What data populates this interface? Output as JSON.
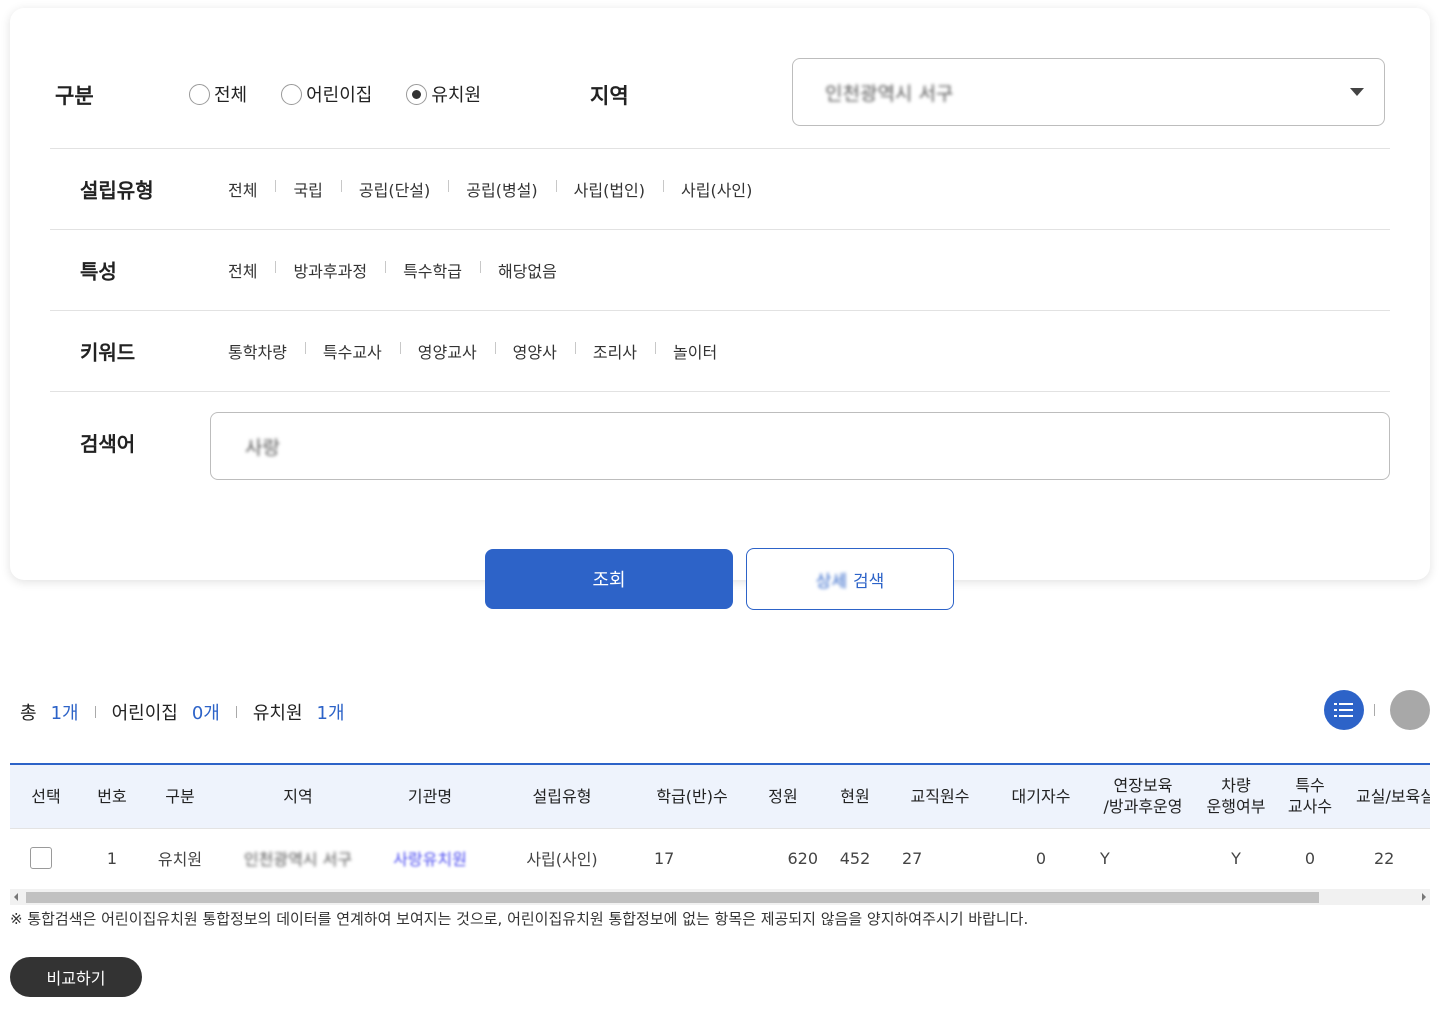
{
  "filters": {
    "type_label": "구분",
    "type_options": [
      "전체",
      "어린이집",
      "유치원"
    ],
    "type_selected": "유치원",
    "region_label": "지역",
    "region_value": "인천광역시 서구",
    "establish_label": "설립유형",
    "establish_options": [
      "전체",
      "국립",
      "공립(단설)",
      "공립(병설)",
      "사립(법인)",
      "사립(사인)"
    ],
    "feature_label": "특성",
    "feature_options": [
      "전체",
      "방과후과정",
      "특수학급",
      "해당없음"
    ],
    "keyword_label": "키워드",
    "keyword_options": [
      "통학차량",
      "특수교사",
      "영양교사",
      "영양사",
      "조리사",
      "놀이터"
    ],
    "search_label": "검색어",
    "search_value": "사랑"
  },
  "buttons": {
    "search": "조회",
    "detail_prefix": "상세",
    "detail": "검색",
    "compare": "비교하기"
  },
  "summary": {
    "total_label": "총",
    "total_count": "1개",
    "daycare_label": "어린이집",
    "daycare_count": "0개",
    "kinder_label": "유치원",
    "kinder_count": "1개"
  },
  "table": {
    "headers": [
      "선택",
      "번호",
      "구분",
      "지역",
      "기관명",
      "설립유형",
      "학급(반)수",
      "정원",
      "현원",
      "교직원수",
      "대기자수",
      "연장보육\n/방과후운영",
      "차량\n운행여부",
      "특수\n교사수",
      "교실/보육실"
    ],
    "rows": [
      [
        "",
        "1",
        "유치원",
        "인천광역시 서구",
        "사랑유치원",
        "사립(사인)",
        "17",
        "620",
        "452",
        "27",
        "0",
        "Y",
        "Y",
        "0",
        "22"
      ]
    ]
  },
  "notice": "※ 통합검색은 어린이집유치원 통합정보의 데이터를 연계하여 보여지는 것으로, 어린이집유치원 통합정보에 없는 항목은 제공되지 않음을 양지하여주시기 바랍니다.",
  "icons": {
    "list_view": "list-icon",
    "map_view": "map-icon",
    "caret": "chevron-down-icon"
  },
  "colors": {
    "primary": "#2d63c8",
    "header_bg": "#eef3fc",
    "compare_btn": "#333333",
    "map_btn": "#a8a8a8"
  }
}
